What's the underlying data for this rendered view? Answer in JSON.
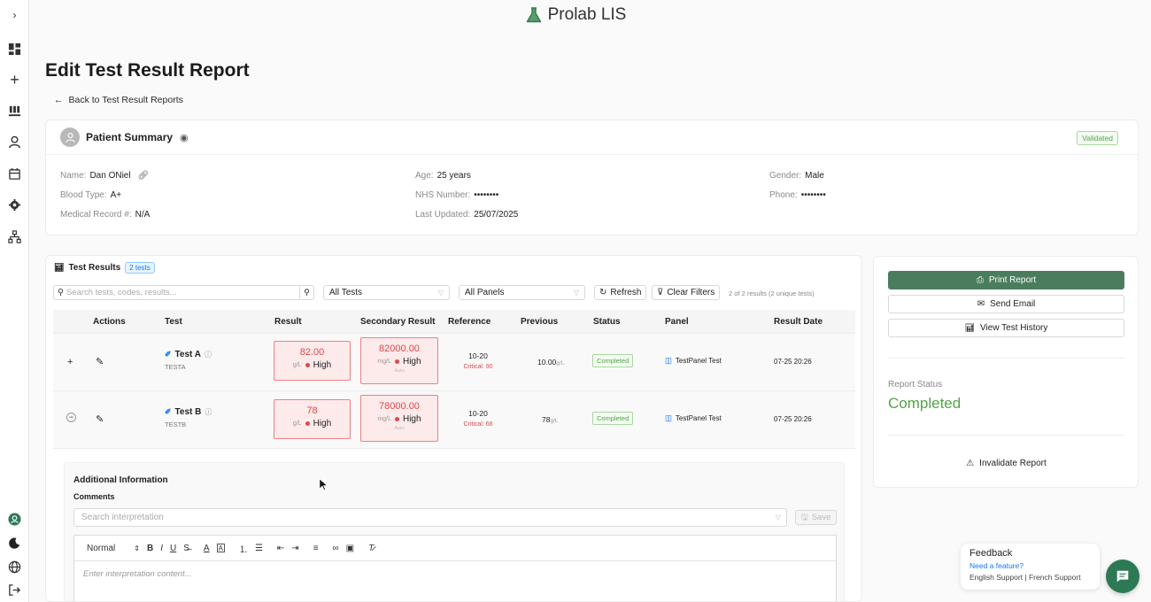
{
  "app": {
    "brand": "Prolab LIS"
  },
  "page": {
    "title": "Edit Test Result Report",
    "back_label": "Back to Test Result Reports"
  },
  "sidebar": {
    "icons": [
      "expand-icon",
      "dashboard-icon",
      "plus-icon",
      "lab-icon",
      "user-icon",
      "calendar-icon",
      "settings-icon",
      "hierarchy-icon"
    ],
    "bottom_icons": [
      "profile-icon",
      "dark-mode-icon",
      "language-icon",
      "logout-icon"
    ]
  },
  "patient": {
    "title": "Patient Summary",
    "status": "Validated",
    "fields": {
      "name_label": "Name:",
      "name": "Dan ONiel",
      "blood_label": "Blood Type:",
      "blood": "A+",
      "mrn_label": "Medical Record #:",
      "mrn": "N/A",
      "age_label": "Age:",
      "age": "25 years",
      "nhs_label": "NHS Number:",
      "nhs": "••••••••",
      "updated_label": "Last Updated:",
      "updated": "25/07/2025",
      "gender_label": "Gender:",
      "gender": "Male",
      "phone_label": "Phone:",
      "phone": "••••••••"
    }
  },
  "results": {
    "title": "Test Results",
    "count_badge": "2 tests",
    "search_placeholder": "Search tests, codes, results...",
    "filter_tests": "All Tests",
    "filter_panels": "All Panels",
    "refresh": "Refresh",
    "clear": "Clear Filters",
    "result_count": "2 of 2 results (2 unique tests)",
    "headers": [
      "Actions",
      "Test",
      "Result",
      "Secondary Result",
      "Reference",
      "Previous",
      "Status",
      "Panel",
      "Result Date"
    ],
    "rows": [
      {
        "expand": "+",
        "name": "Test A",
        "code": "TESTA",
        "result": "82.00",
        "result_unit": "g/L",
        "result_flag": "High",
        "secondary": "82000.00",
        "secondary_unit": "mg/L",
        "secondary_flag": "High",
        "secondary_auto": "Auto",
        "ref": "10-20",
        "critical": "Critical: 90",
        "previous": "10.00",
        "previous_unit": "g/L",
        "status": "Completed",
        "panel": "TestPanel Test",
        "date": "07-25 20:26"
      },
      {
        "expand": "−",
        "name": "Test B",
        "code": "TESTB",
        "result": "78",
        "result_unit": "g/L",
        "result_flag": "High",
        "secondary": "78000.00",
        "secondary_unit": "mg/L",
        "secondary_flag": "High",
        "secondary_auto": "Auto",
        "ref": "10-20",
        "critical": "Critical: 66",
        "previous": "78",
        "previous_unit": "g/L",
        "status": "Completed",
        "panel": "TestPanel Test",
        "date": "07-25 20:26"
      }
    ]
  },
  "additional": {
    "title": "Additional Information",
    "comments": "Comments",
    "interp_placeholder": "Search interpretation",
    "save": "Save",
    "editor_style": "Normal",
    "editor_placeholder": "Enter interpretation content..."
  },
  "actions": {
    "print": "Print Report",
    "email": "Send Email",
    "history": "View Test History",
    "status_label": "Report Status",
    "status_value": "Completed",
    "invalidate": "Invalidate Report"
  },
  "feedback": {
    "title": "Feedback",
    "need": "Need a feature?",
    "english": "English Support",
    "sep": "|",
    "french": "French Support"
  },
  "colors": {
    "accent": "#4a7d5e",
    "success": "#52a447",
    "danger": "#e04848",
    "link": "#1677ff"
  }
}
